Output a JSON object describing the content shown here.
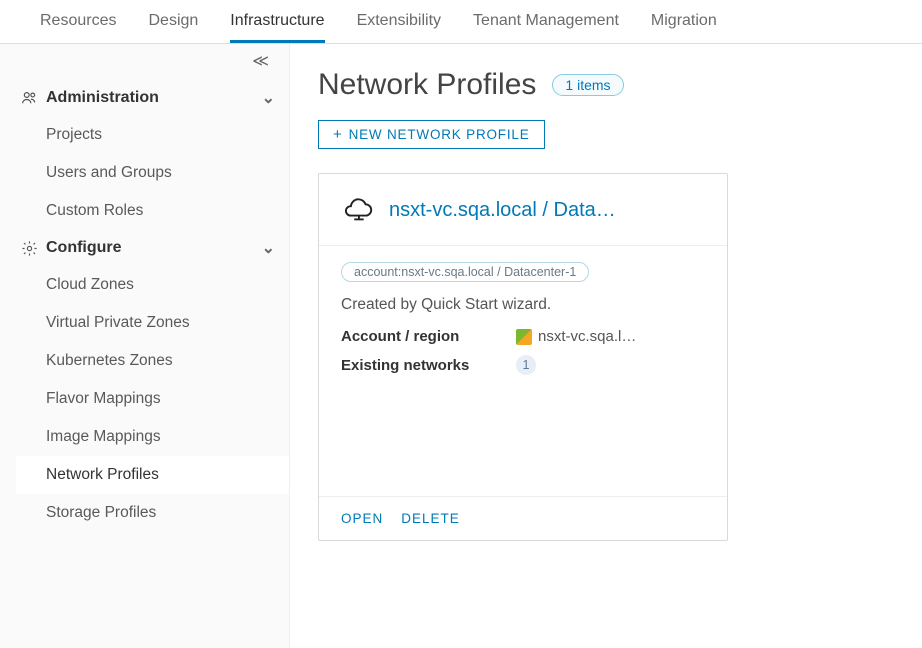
{
  "topnav": {
    "tabs": [
      {
        "label": "Resources"
      },
      {
        "label": "Design"
      },
      {
        "label": "Infrastructure",
        "active": true
      },
      {
        "label": "Extensibility"
      },
      {
        "label": "Tenant Management"
      },
      {
        "label": "Migration"
      }
    ]
  },
  "sidebar": {
    "sections": [
      {
        "icon": "people",
        "label": "Administration",
        "items": [
          {
            "label": "Projects"
          },
          {
            "label": "Users and Groups"
          },
          {
            "label": "Custom Roles"
          }
        ]
      },
      {
        "icon": "gear",
        "label": "Configure",
        "items": [
          {
            "label": "Cloud Zones"
          },
          {
            "label": "Virtual Private Zones"
          },
          {
            "label": "Kubernetes Zones"
          },
          {
            "label": "Flavor Mappings"
          },
          {
            "label": "Image Mappings"
          },
          {
            "label": "Network Profiles",
            "active": true
          },
          {
            "label": "Storage Profiles"
          }
        ]
      }
    ]
  },
  "page": {
    "title": "Network Profiles",
    "items_badge": "1 items",
    "new_button": "NEW NETWORK PROFILE"
  },
  "card": {
    "title": "nsxt-vc.sqa.local / Data…",
    "tag": "account:nsxt-vc.sqa.local / Datacenter-1",
    "description": "Created by Quick Start wizard.",
    "account_region_label": "Account / region",
    "account_region_value": "nsxt-vc.sqa.l…",
    "existing_networks_label": "Existing networks",
    "existing_networks_count": "1",
    "open_label": "OPEN",
    "delete_label": "DELETE"
  }
}
